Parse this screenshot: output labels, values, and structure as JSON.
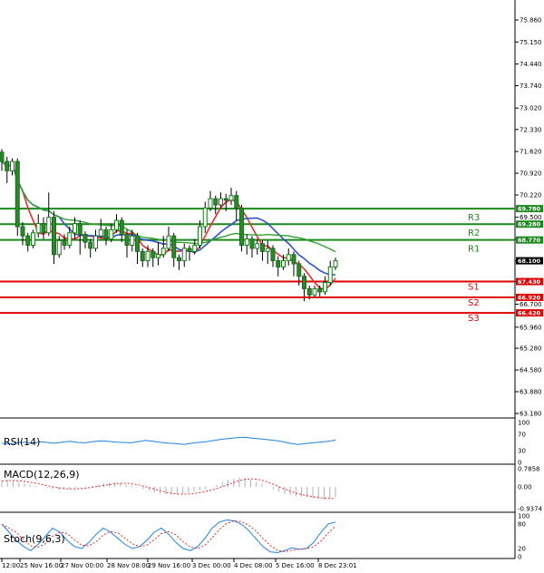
{
  "chart_data": {
    "type": "candlestick",
    "title": "",
    "price_axis": {
      "ticks": [
        "75.860",
        "75.150",
        "74.440",
        "73.740",
        "73.020",
        "72.330",
        "71.620",
        "70.920",
        "70.220",
        "69.500",
        "68.800",
        "68.100",
        "67.430",
        "66.700",
        "65.960",
        "65.280",
        "64.580",
        "63.880",
        "63.180"
      ],
      "ylim": [
        63.18,
        76.21
      ]
    },
    "x_axis": {
      "tick_labels": [
        "12:00",
        "25 Nov 16:00",
        "27 Nov 00:00",
        "28 Nov 08:00",
        "29 Nov 16:00",
        "3 Dec 00:00",
        "4 Dec 08:00",
        "5 Dec 16:00",
        "8 Dec 23:01"
      ]
    },
    "current_price": "68.100",
    "levels": [
      {
        "name": "R3",
        "label": "69.780",
        "value": 69.78,
        "color": "#1a8a1a"
      },
      {
        "name": "R2",
        "label": "69.280",
        "value": 69.28,
        "color": "#1a8a1a"
      },
      {
        "name": "R1",
        "label": "68.770",
        "value": 68.77,
        "color": "#1a8a1a"
      },
      {
        "name": "S1",
        "label": "67.430",
        "value": 67.43,
        "color": "#e00000"
      },
      {
        "name": "S2",
        "label": "66.920",
        "value": 66.92,
        "color": "#e00000"
      },
      {
        "name": "S3",
        "label": "66.420",
        "value": 66.42,
        "color": "#e00000"
      }
    ],
    "candles": [
      [
        71.6,
        71.3,
        71.7,
        71.0
      ],
      [
        71.3,
        71.0,
        71.45,
        70.6
      ],
      [
        71.0,
        71.3,
        71.4,
        70.85
      ],
      [
        71.3,
        69.2,
        71.4,
        68.9
      ],
      [
        69.2,
        68.9,
        69.35,
        68.6
      ],
      [
        68.9,
        68.6,
        69.0,
        68.4
      ],
      [
        68.6,
        69.0,
        69.1,
        68.5
      ],
      [
        69.0,
        69.3,
        69.6,
        68.85
      ],
      [
        69.3,
        69.0,
        69.5,
        68.8
      ],
      [
        69.0,
        69.5,
        70.3,
        68.9
      ],
      [
        69.5,
        68.3,
        69.7,
        68.0
      ],
      [
        68.3,
        68.75,
        68.9,
        68.2
      ],
      [
        68.75,
        68.6,
        68.95,
        68.45
      ],
      [
        68.6,
        69.0,
        69.2,
        68.5
      ],
      [
        69.0,
        69.3,
        69.5,
        68.8
      ],
      [
        69.3,
        68.95,
        69.4,
        68.3
      ],
      [
        68.95,
        68.7,
        69.05,
        68.5
      ],
      [
        68.7,
        68.5,
        68.8,
        68.2
      ],
      [
        68.5,
        68.9,
        69.1,
        68.4
      ],
      [
        68.9,
        69.1,
        69.45,
        68.85
      ],
      [
        69.1,
        68.8,
        69.2,
        68.6
      ],
      [
        68.8,
        69.1,
        69.3,
        68.7
      ],
      [
        69.1,
        69.4,
        69.6,
        69.0
      ],
      [
        69.4,
        68.95,
        69.5,
        68.7
      ],
      [
        68.95,
        68.6,
        69.1,
        68.2
      ],
      [
        68.6,
        68.9,
        69.1,
        68.4
      ],
      [
        68.9,
        68.4,
        69.0,
        68.0
      ],
      [
        68.4,
        68.1,
        68.5,
        67.9
      ],
      [
        68.1,
        68.4,
        68.6,
        67.9
      ],
      [
        68.4,
        68.2,
        68.5,
        67.9
      ],
      [
        68.2,
        68.3,
        68.7,
        67.95
      ],
      [
        68.3,
        68.5,
        68.9,
        68.2
      ],
      [
        68.5,
        68.9,
        69.2,
        68.4
      ],
      [
        68.9,
        68.2,
        69.0,
        67.9
      ],
      [
        68.2,
        68.1,
        68.3,
        67.8
      ],
      [
        68.1,
        68.5,
        68.65,
        67.9
      ],
      [
        68.5,
        68.4,
        68.6,
        68.1
      ],
      [
        68.4,
        68.6,
        68.8,
        68.3
      ],
      [
        68.6,
        69.2,
        69.4,
        68.5
      ],
      [
        69.2,
        69.8,
        70.0,
        69.0
      ],
      [
        69.8,
        70.1,
        70.35,
        69.7
      ],
      [
        70.1,
        69.9,
        70.2,
        69.6
      ],
      [
        69.9,
        70.1,
        70.3,
        69.8
      ],
      [
        70.1,
        70.05,
        70.25,
        69.7
      ],
      [
        70.05,
        70.2,
        70.45,
        69.9
      ],
      [
        70.2,
        69.8,
        70.35,
        69.4
      ],
      [
        69.8,
        68.6,
        69.9,
        68.4
      ],
      [
        68.6,
        68.8,
        68.95,
        68.3
      ],
      [
        68.8,
        68.5,
        68.9,
        68.2
      ],
      [
        68.5,
        68.65,
        68.8,
        68.3
      ],
      [
        68.65,
        68.4,
        68.75,
        68.1
      ],
      [
        68.4,
        68.5,
        68.75,
        68.0
      ],
      [
        68.5,
        68.1,
        68.6,
        67.9
      ],
      [
        68.1,
        67.9,
        68.25,
        67.6
      ],
      [
        67.9,
        68.1,
        68.3,
        67.8
      ],
      [
        68.1,
        68.3,
        68.5,
        67.95
      ],
      [
        68.3,
        68.0,
        68.4,
        67.6
      ],
      [
        68.0,
        67.6,
        68.1,
        67.3
      ],
      [
        67.6,
        67.2,
        67.7,
        66.8
      ],
      [
        67.2,
        67.0,
        67.3,
        66.85
      ],
      [
        67.0,
        67.2,
        67.3,
        66.9
      ],
      [
        67.2,
        67.1,
        67.3,
        66.95
      ],
      [
        67.1,
        67.4,
        67.6,
        67.0
      ],
      [
        67.4,
        67.9,
        68.1,
        67.3
      ],
      [
        67.9,
        68.1,
        68.2,
        67.8
      ]
    ],
    "rsi": {
      "label": "RSI(14)",
      "ticks": [
        "100",
        "70",
        "30",
        "0"
      ],
      "values": [
        48,
        46,
        49,
        51,
        47,
        52,
        50,
        48,
        51,
        53,
        50,
        49,
        52,
        54,
        53,
        51,
        50,
        49,
        52,
        55,
        53,
        50,
        48,
        47,
        45,
        48,
        50,
        52,
        55,
        58,
        60,
        62,
        63,
        61,
        59,
        57,
        55,
        52,
        48,
        45,
        47,
        49,
        51,
        53,
        56
      ]
    },
    "macd": {
      "label": "MACD(12,26,9)",
      "ticks": [
        "0.7858",
        "0.00",
        "-0.9374"
      ],
      "hist": [
        0.25,
        0.3,
        0.28,
        0.22,
        0.15,
        0.1,
        0.05,
        0.0,
        -0.05,
        -0.1,
        -0.12,
        -0.1,
        -0.08,
        -0.05,
        -0.02,
        0.02,
        0.05,
        0.1,
        0.15,
        0.18,
        0.2,
        0.15,
        0.1,
        0.05,
        -0.02,
        -0.1,
        -0.18,
        -0.25,
        -0.3,
        -0.32,
        -0.35,
        -0.33,
        -0.3,
        -0.25,
        -0.2,
        -0.15,
        -0.1,
        0.0,
        0.1,
        0.2,
        0.3,
        0.35,
        0.4,
        0.38,
        0.32,
        0.22,
        0.12,
        0.0,
        -0.1,
        -0.2,
        -0.3,
        -0.35,
        -0.4,
        -0.42,
        -0.45,
        -0.5,
        -0.52,
        -0.55,
        -0.5,
        -0.45
      ]
    },
    "stoch": {
      "label": "Stoch(9,6,3)",
      "ticks": [
        "100",
        "80",
        "20",
        "0"
      ],
      "k": [
        80,
        60,
        40,
        25,
        15,
        30,
        50,
        70,
        60,
        40,
        25,
        20,
        35,
        55,
        70,
        60,
        45,
        30,
        20,
        25,
        40,
        60,
        70,
        55,
        35,
        20,
        15,
        25,
        45,
        70,
        85,
        90,
        88,
        80,
        65,
        45,
        25,
        12,
        10,
        15,
        22,
        18,
        20,
        35,
        60,
        80,
        85
      ]
    }
  }
}
